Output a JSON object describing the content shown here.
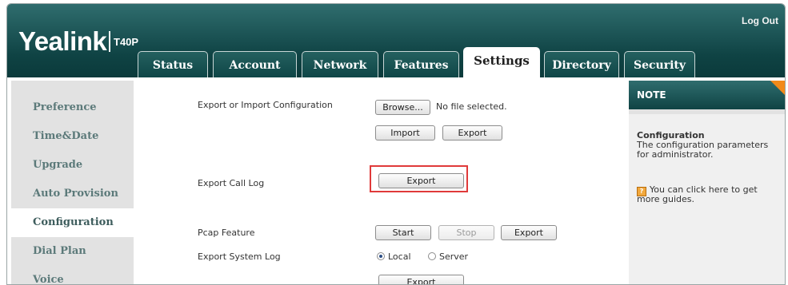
{
  "header": {
    "brand": "Yealink",
    "model": "T40P",
    "logout_label": "Log Out"
  },
  "tabs": [
    {
      "label": "Status"
    },
    {
      "label": "Account"
    },
    {
      "label": "Network"
    },
    {
      "label": "Features"
    },
    {
      "label": "Settings",
      "active": true
    },
    {
      "label": "Directory"
    },
    {
      "label": "Security"
    }
  ],
  "sidebar": {
    "items": [
      {
        "label": "Preference"
      },
      {
        "label": "Time&Date"
      },
      {
        "label": "Upgrade"
      },
      {
        "label": "Auto Provision"
      },
      {
        "label": "Configuration",
        "active": true
      },
      {
        "label": "Dial Plan"
      },
      {
        "label": "Voice"
      }
    ]
  },
  "main": {
    "export_import_label": "Export or Import Configuration",
    "browse_label": "Browse...",
    "file_status": "No file selected.",
    "import_label": "Import",
    "export_label": "Export",
    "export_call_log_label": "Export Call Log",
    "call_log_export_label": "Export",
    "pcap_label": "Pcap Feature",
    "pcap_start_label": "Start",
    "pcap_stop_label": "Stop",
    "pcap_export_label": "Export",
    "system_log_label": "Export System Log",
    "local_label": "Local",
    "server_label": "Server",
    "system_log_selected": "Local",
    "system_log_export_label": "Export"
  },
  "note": {
    "title": "NOTE",
    "heading": "Configuration",
    "line1": "The configuration parameters",
    "line2": "for administrator.",
    "help_line1": "You can click here to get",
    "help_line2": "more guides."
  },
  "colors": {
    "header_teal": "#0f4344",
    "highlight_red": "#e03a3a",
    "note_accent_orange": "#f28a1a"
  }
}
